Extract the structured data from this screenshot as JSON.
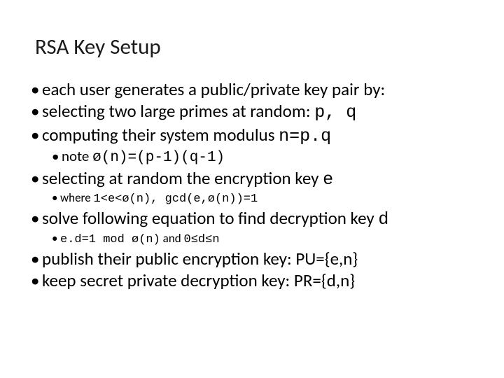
{
  "title": "RSA Key Setup",
  "bullets": {
    "b1": "each user generates a public/private key pair by:",
    "b2_pre": "selecting two large primes at random: ",
    "b2_mono": "p, q",
    "b3_pre": "computing their system modulus ",
    "b3_mono": "n=p.q",
    "b3_sub_pre": "note ",
    "b3_sub_mono": "ø(n)=(p-1)(q-1)",
    "b4_pre": "selecting at random the encryption key ",
    "b4_mono": "e",
    "b4_sub_pre": "where ",
    "b4_sub_mono": "1<e<ø(n), gcd(e,ø(n))=1",
    "b5_pre": "solve following equation to find decryption key ",
    "b5_mono": "d",
    "b5_sub_mono1": "e.d=1 mod ø(n)",
    "b5_sub_mid": " and ",
    "b5_sub_mono2": "0≤d≤n",
    "b6": "publish their public encryption key: PU={e,n}",
    "b7": "keep secret private decryption key: PR={d,n}"
  }
}
